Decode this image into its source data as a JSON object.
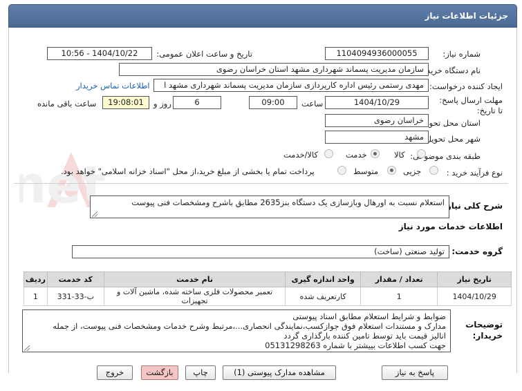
{
  "header": {
    "title": "جزئیات اطلاعات نیاز"
  },
  "fields": {
    "need_number_label": "شماره نیاز:",
    "need_number": "1104094936000055",
    "announce_label": "تاریخ و ساعت اعلان عمومی:",
    "announce_value": "1404/10/22 - 10:56",
    "buyer_label": "نام دستگاه خریدار:",
    "buyer_value": "سازمان مدیریت پسماند شهرداری مشهد استان خراسان رضوی",
    "creator_label": "ایجاد کننده درخواست:",
    "creator_value": "مهدی رستمی رئیس اداره کارپردازی سازمان مدیریت پسماند شهرداری مشهد ا",
    "contact_link": "اطلاعات تماس خریدار",
    "deadline_label": "مهلت ارسال پاسخ: تا تاریخ:",
    "deadline_date": "1404/10/29",
    "time_label": "ساعت",
    "deadline_time": "09:00",
    "days_value": "6",
    "days_label": "روز و",
    "remaining_time": "19:08:01",
    "remaining_label": "ساعت باقی مانده",
    "province_label": "استان محل تحویل:",
    "province_value": "خراسان رضوی",
    "city_label": "شهر محل تحویل:",
    "city_value": "مشهد",
    "category_label": "طبقه بندی موضوعی:",
    "category_options": [
      "کالا",
      "خدمت",
      "کالا/خدمت"
    ],
    "category_selected": "خدمت",
    "process_label": "نوع فرآیند خرید :",
    "process_options": [
      "جزیی",
      "متوسط"
    ],
    "process_selected": "متوسط",
    "payment_note": "پرداخت تمام یا بخشی از مبلغ خرید،از محل \"اسناد خزانه اسلامی\" خواهد بود."
  },
  "description": {
    "label": "شرح کلی نیاز:",
    "text": "استعلام نسبت به اورهال وبازسازی یک دستگاه بنز2635 مطابق باشرح ومشخصات فنی پیوست"
  },
  "services": {
    "section_title": "اطلاعات خدمات مورد نیاز",
    "group_label": "گروه خدمت:",
    "group_value": "تولید صنعتی (ساخت)",
    "columns": [
      "ردیف",
      "کد خدمت",
      "نام خدمت",
      "واحد اندازه گیری",
      "تعداد / مقدار",
      "تاریخ نیاز"
    ],
    "rows": [
      [
        "1",
        "ب-33-331",
        "تعمیر محصولات فلزی ساخته شده، ماشین آلات و تجهیزات",
        "کارتعریف شده",
        "1",
        "1404/10/29"
      ]
    ]
  },
  "buyer_notes": {
    "label": "توضیحات خریدار:",
    "lines": [
      "ضوابط و شرایط استعلام مطابق اسناد پیوستی",
      "مدارک و مستندات استعلام فوق جوازکسب،نمایندگی انحصاری...،مرتبط وشرح خدمات ومشخصات فنی پیوست، از جمله",
      "انالیز قیمت باید توسط تامین کننده بارگذاری گردد",
      "جهت کسب اطلاعات بییشتر با شماره 05131298263"
    ]
  },
  "buttons": {
    "reply": "پاسخ به نیاز",
    "attachments": "مشاهده مدارک پیوستی (1)",
    "print": "چاپ",
    "back": "بازگشت",
    "exit": "خروج"
  },
  "watermark": {
    "text": "AriaTender.net"
  },
  "colors": {
    "header": "#5f7fa8",
    "link": "#1a5fb4",
    "highlight": "#fdfbcf",
    "button_pink": "#f5c6c6"
  }
}
